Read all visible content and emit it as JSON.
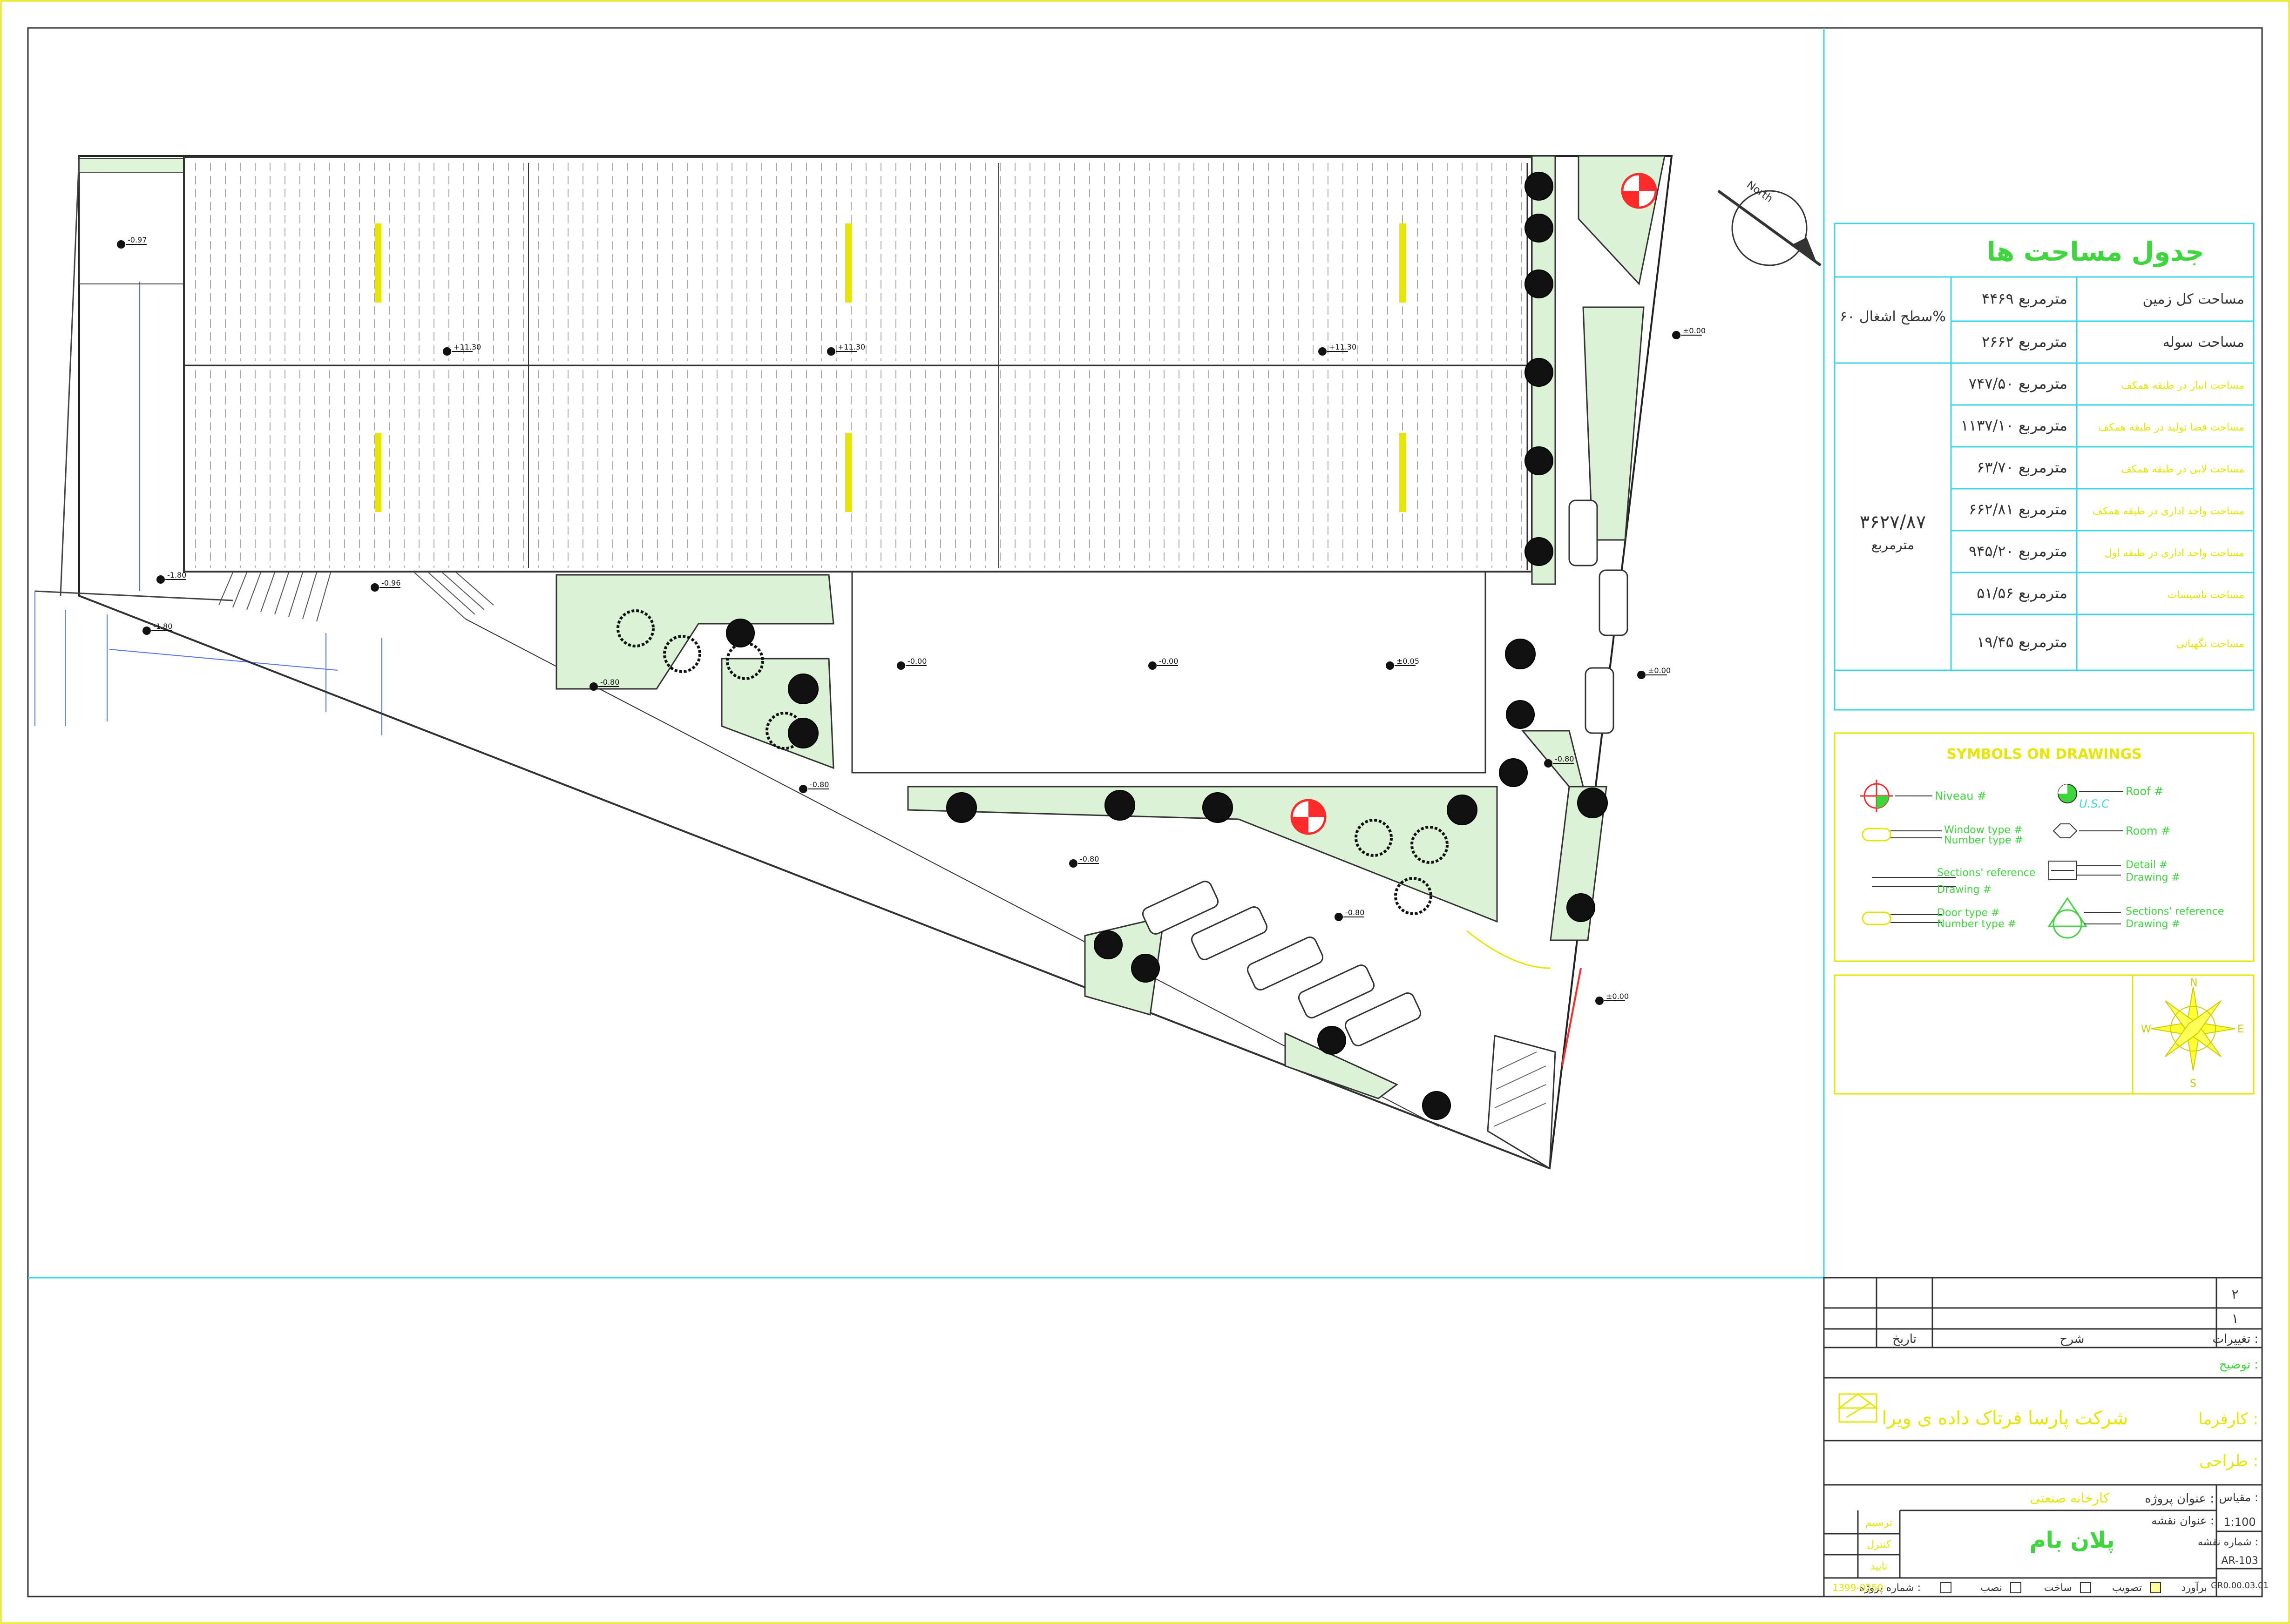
{
  "area_table": {
    "title": "جدول مساحت ها",
    "occupancy": "سطح اشغال ۶۰%",
    "total_sum": "۳۶۲۷/۸۷",
    "total_unit": "مترمربع",
    "rows": [
      {
        "label": "مساحت کل زمین",
        "value": "۴۴۶۹ مترمربع"
      },
      {
        "label": "مساحت سوله",
        "value": "۲۶۶۲ مترمربع"
      },
      {
        "label": "مساحت انبار در طبقه همکف",
        "value": "۷۴۷/۵۰ مترمربع"
      },
      {
        "label": "مساحت فضا تولید در طبقه همکف",
        "value": "۱۱۳۷/۱۰ مترمربع"
      },
      {
        "label": "مساحت لابی در طبقه همکف",
        "value": "۶۳/۷۰ مترمربع"
      },
      {
        "label": "مساحت واحد اداری در طبقه همکف",
        "value": "۶۶۲/۸۱ مترمربع"
      },
      {
        "label": "مساحت واحد اداری در طبقه اول",
        "value": "۹۴۵/۲۰ مترمربع"
      },
      {
        "label": "مساحت تاسیسات",
        "value": "۵۱/۵۶ مترمربع"
      },
      {
        "label": "مساحت نگهبانی",
        "value": "۱۹/۴۵ مترمربع"
      }
    ]
  },
  "symbols": {
    "title": "SYMBOLS ON DRAWINGS",
    "niveau": "Niveau #",
    "roof": "Roof #",
    "roof_tag": "U.S.C",
    "window_type": "Window type #",
    "window_number": "Number type #",
    "room": "Room #",
    "detail": "Detail #",
    "detail_drawing": "Drawing #",
    "section_ref": "Sections' reference",
    "section_drawing": "Drawing #",
    "door_type": "Door type #",
    "door_number": "Number type #",
    "section_ref2": "Sections' reference",
    "section_drawing2": "Drawing #"
  },
  "compass_panel": {
    "n": "N",
    "s": "S",
    "e": "E",
    "w": "W"
  },
  "site_north": "North",
  "levels": {
    "top_left": "-0.97",
    "roof_1": "+11.30",
    "roof_2": "+11.30",
    "roof_3": "+11.30",
    "right_1": "±0.00",
    "left_1": "-1.80",
    "left_2": "-1.80",
    "stair": "-0.96",
    "road": "-0.80",
    "yard_1": "-0.00",
    "yard_2": "-0.00",
    "yard_3": "±0.05",
    "right_2": "±0.00",
    "mid_1": "-0.80",
    "mid_2": "-0.80",
    "mid_3": "-0.80",
    "park": "-0.80",
    "gate": "±0.00"
  },
  "title_block": {
    "rev_2": "۲",
    "rev_1": "۱",
    "changes_label": "تغییرات :",
    "desc_label": "شرح",
    "date_label": "تاریخ",
    "note_label": "توضیح :",
    "client_label": "کارفرما :",
    "client_name": "شرکت پارسا فرتاک داده ی ویرا",
    "design_label": "طراحی :",
    "scale_label": "مقیاس :",
    "scale_value": "1:100",
    "project_title_label": "عنوان پروژه :",
    "project_title_value": "کارخانه صنعتی",
    "sheet_title_label": "عنوان نقشه :",
    "sheet_title_value": "پلان بام",
    "sheet_no_label": "شماره نقشه :",
    "sheet_no_value": "AR-103",
    "sheet_code": "GR0.00.03.01",
    "drawn_label": "ترسیم",
    "checked_label": "کنترل",
    "approved_label": "تایید",
    "project_no_label": "شماره پروژه :",
    "project_no_value": "1399-0250",
    "phase_estimate": "برآورد",
    "phase_approval": "تصویب",
    "phase_build": "ساخت",
    "phase_install": "نصب"
  }
}
